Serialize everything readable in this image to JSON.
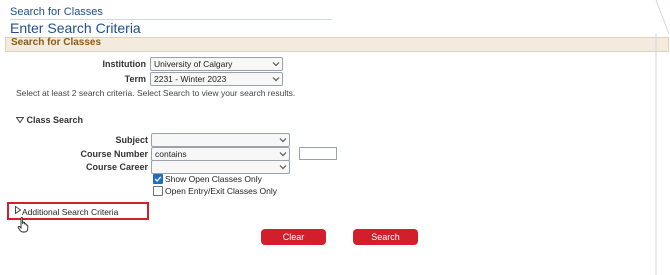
{
  "header": {
    "breadcrumb": "Search for Classes",
    "title": "Enter Search Criteria"
  },
  "section": {
    "title": "Search for Classes"
  },
  "criteria": {
    "institution": {
      "label": "Institution",
      "value": "University of Calgary"
    },
    "term": {
      "label": "Term",
      "value": "2231 - Winter 2023"
    },
    "instructions": "Select at least 2 search criteria. Select Search to view your search results."
  },
  "class_search": {
    "heading": "Class Search",
    "subject": {
      "label": "Subject",
      "value": ""
    },
    "course_number": {
      "label": "Course Number",
      "operator": "contains",
      "value": ""
    },
    "course_career": {
      "label": "Course Career",
      "value": ""
    },
    "show_open": {
      "label": "Show Open Classes Only",
      "checked": true
    },
    "open_entry": {
      "label": "Open Entry/Exit Classes Only",
      "checked": false
    }
  },
  "additional": {
    "label": "Additional Search Criteria"
  },
  "buttons": {
    "clear": "Clear",
    "search": "Search"
  },
  "colors": {
    "accent": "#d21f2b",
    "link": "#1f4e8c",
    "section": "#8a5a17"
  }
}
